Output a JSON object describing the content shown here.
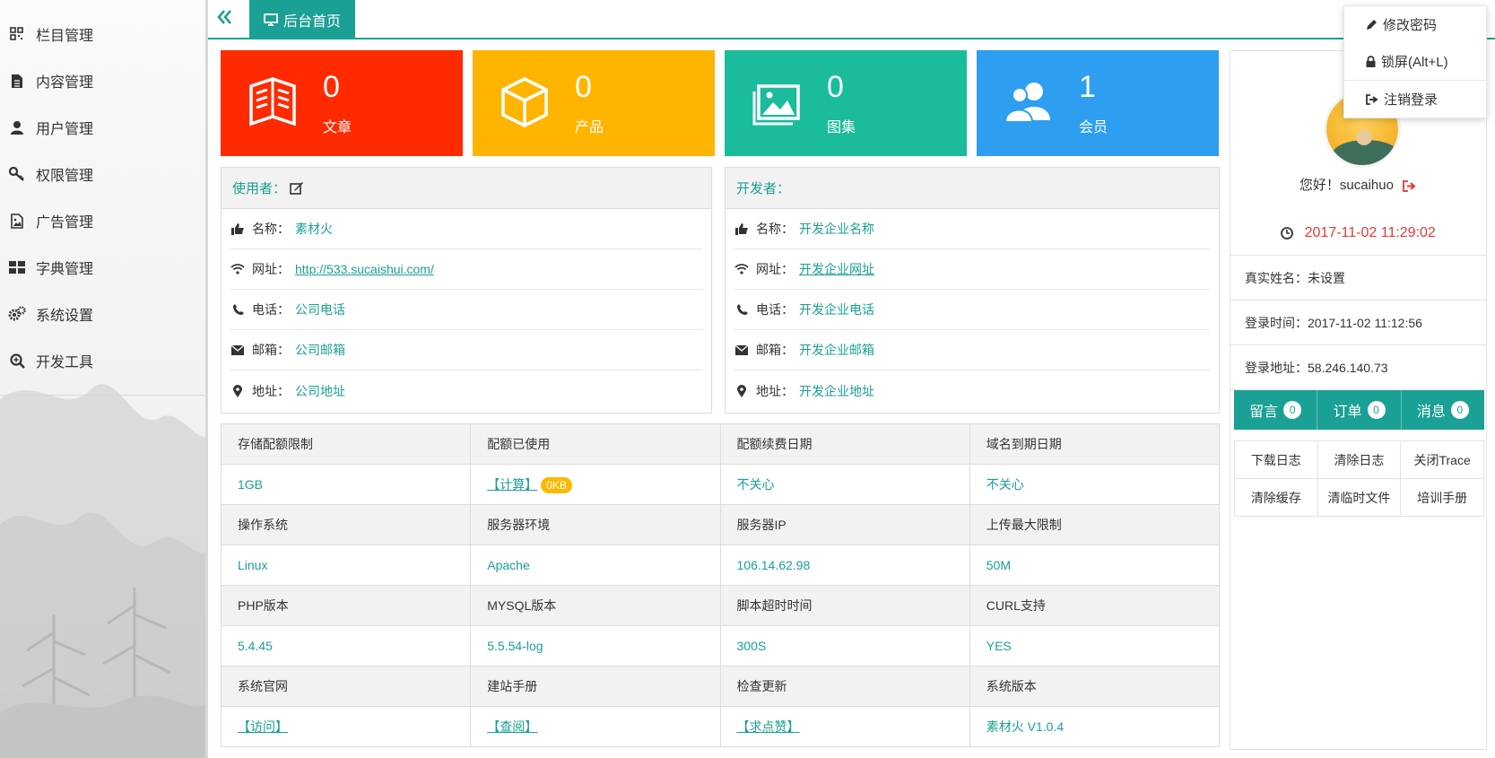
{
  "sidebar": {
    "items": [
      {
        "label": "栏目管理",
        "icon": "grid-icon"
      },
      {
        "label": "内容管理",
        "icon": "document-icon"
      },
      {
        "label": "用户管理",
        "icon": "user-icon"
      },
      {
        "label": "权限管理",
        "icon": "key-icon"
      },
      {
        "label": "广告管理",
        "icon": "image-file-icon"
      },
      {
        "label": "字典管理",
        "icon": "tiles-icon"
      },
      {
        "label": "系统设置",
        "icon": "gears-icon"
      },
      {
        "label": "开发工具",
        "icon": "search-plus-icon"
      }
    ]
  },
  "tabbar": {
    "collapse_icon": "double-chevron-left-icon",
    "home_tab": "后台首页",
    "home_icon": "monitor-icon"
  },
  "stats": [
    {
      "value": "0",
      "label": "文章",
      "color": "#ff2a00",
      "icon": "book-icon"
    },
    {
      "value": "0",
      "label": "产品",
      "color": "#ffb400",
      "icon": "cube-icon"
    },
    {
      "value": "0",
      "label": "图集",
      "color": "#1bbc9b",
      "icon": "picture-icon"
    },
    {
      "value": "1",
      "label": "会员",
      "color": "#2d9ef0",
      "icon": "users-icon"
    }
  ],
  "user_panel": {
    "title": "使用者：",
    "rows": [
      {
        "key": "名称：",
        "value": "素材火"
      },
      {
        "key": "网址：",
        "value": "http://533.sucaishui.com/"
      },
      {
        "key": "电话：",
        "value": "公司电话"
      },
      {
        "key": "邮箱：",
        "value": "公司邮箱"
      },
      {
        "key": "地址：",
        "value": "公司地址"
      }
    ]
  },
  "dev_panel": {
    "title": "开发者：",
    "rows": [
      {
        "key": "名称：",
        "value": "开发企业名称"
      },
      {
        "key": "网址：",
        "value": "开发企业网址"
      },
      {
        "key": "电话：",
        "value": "开发企业电话"
      },
      {
        "key": "邮箱：",
        "value": "开发企业邮箱"
      },
      {
        "key": "地址：",
        "value": "开发企业地址"
      }
    ]
  },
  "server": {
    "rows": [
      [
        "存储配额限制",
        "配额已使用",
        "配额续费日期",
        "域名到期日期"
      ],
      [
        "1GB",
        "【计算】",
        "不关心",
        "不关心"
      ],
      [
        "操作系统",
        "服务器环境",
        "服务器IP",
        "上传最大限制"
      ],
      [
        "Linux",
        "Apache",
        "106.14.62.98",
        "50M"
      ],
      [
        "PHP版本",
        "MYSQL版本",
        "脚本超时时间",
        "CURL支持"
      ],
      [
        "5.4.45",
        "5.5.54-log",
        "300S",
        "YES"
      ],
      [
        "系统官网",
        "建站手册",
        "检查更新",
        "系统版本"
      ],
      [
        "【访问】",
        "【查阅】",
        "【求点赞】",
        "素材火 V1.0.4"
      ]
    ],
    "quota_badge": "0KB"
  },
  "profile": {
    "greeting": "您好！sucaihuo",
    "datetime": "2017-11-02 11:29:02",
    "real_name": "真实姓名：未设置",
    "login_time": "登录时间：2017-11-02 11:12:56",
    "login_ip": "登录地址：58.246.140.73",
    "tabs": [
      {
        "label": "留言",
        "count": "0"
      },
      {
        "label": "订单",
        "count": "0"
      },
      {
        "label": "消息",
        "count": "0"
      }
    ],
    "buttons": [
      "下载日志",
      "清除日志",
      "关闭Trace",
      "清除缓存",
      "清临时文件",
      "培训手册"
    ]
  },
  "dropdown": {
    "change_password": "修改密码",
    "lock_screen": "锁屏(Alt+L)",
    "logout": "注销登录"
  }
}
